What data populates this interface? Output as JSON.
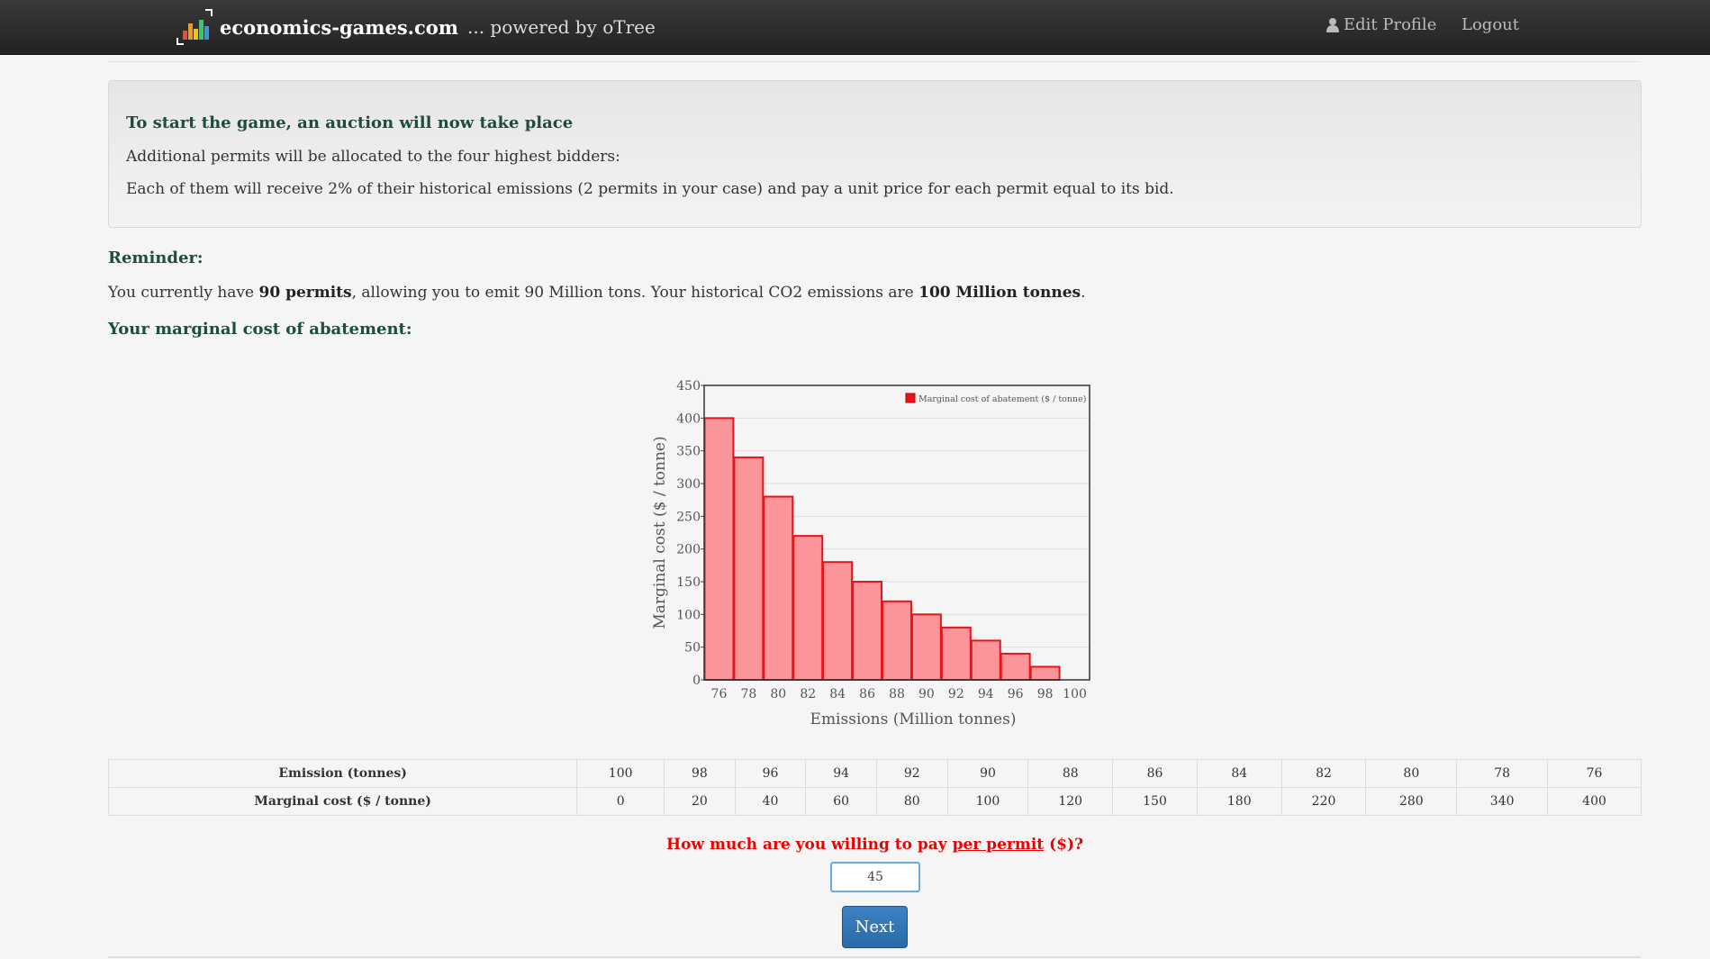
{
  "navbar": {
    "brand": "economics-games.com",
    "powered": "... powered by oTree",
    "edit_profile": "Edit Profile",
    "logout": "Logout",
    "logo_colors": [
      "#e74c3c",
      "#f39c12",
      "#f1c40f",
      "#2ecc71",
      "#3498db",
      "#9b59b6"
    ]
  },
  "intro": {
    "title": "To start the game, an auction will now take place",
    "line1": "Additional permits will be allocated to the four highest bidders:",
    "line2": "Each of them will receive 2% of their historical emissions (2 permits in your case) and pay a unit price for each permit equal to its bid."
  },
  "reminder": {
    "heading": "Reminder:",
    "t1": "You currently have ",
    "b1": "90 permits",
    "t2": ", allowing you to emit 90 Million tons. Your historical CO2 emissions are ",
    "b2": "100 Million tonnes",
    "t3": "."
  },
  "mca_heading": "Your marginal cost of abatement:",
  "chart_data": {
    "type": "bar",
    "categories": [
      "76",
      "78",
      "80",
      "82",
      "84",
      "86",
      "88",
      "90",
      "92",
      "94",
      "96",
      "98",
      "100"
    ],
    "series": [
      {
        "name": "Marginal cost of abatement ($ / tonne)",
        "values": [
          400,
          340,
          280,
          220,
          180,
          150,
          120,
          100,
          80,
          60,
          40,
          20,
          0
        ]
      }
    ],
    "xlabel": "Emissions (Million tonnes)",
    "ylabel": "Marginal cost ($ / tonne)",
    "ylim": [
      0,
      450
    ],
    "yticks": [
      0,
      50,
      100,
      150,
      200,
      250,
      300,
      350,
      400,
      450
    ],
    "grid": true,
    "legend": "top-right",
    "colors": {
      "fill": "#fb9599",
      "stroke": "#e8141b"
    }
  },
  "table": {
    "row1_label": "Emission (tonnes)",
    "row2_label": "Marginal cost ($ / tonne)",
    "emissions": [
      "100",
      "98",
      "96",
      "94",
      "92",
      "90",
      "88",
      "86",
      "84",
      "82",
      "80",
      "78",
      "76"
    ],
    "costs": [
      "0",
      "20",
      "40",
      "60",
      "80",
      "100",
      "120",
      "150",
      "180",
      "220",
      "280",
      "340",
      "400"
    ]
  },
  "question": {
    "pre": "How much are you willing to pay ",
    "underlined": "per permit",
    "post": " ($)?"
  },
  "bid": {
    "value": "45"
  },
  "next_label": "Next"
}
